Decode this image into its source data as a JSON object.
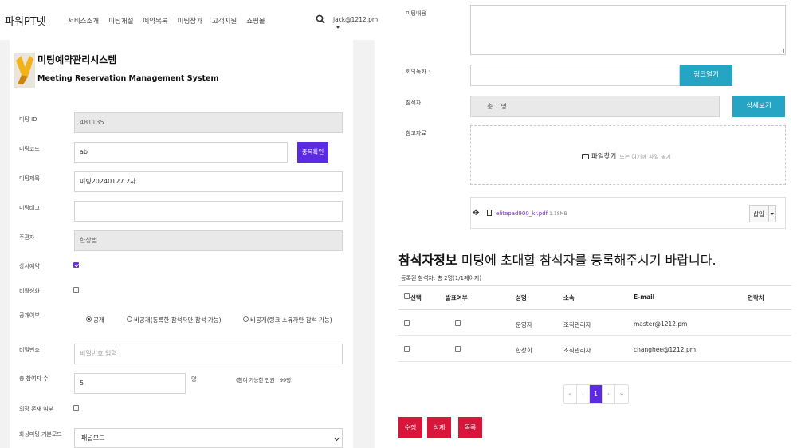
{
  "nav": {
    "brand": "파워PT넷",
    "menu": [
      "서비스소개",
      "미팅개설",
      "예약목록",
      "미팅참가",
      "고객지원",
      "쇼핑몰"
    ],
    "user": "jack@1212.pm"
  },
  "system": {
    "title_ko": "미팅예약관리시스템",
    "title_en": "Meeting Reservation Management System"
  },
  "form": {
    "meeting_id_label": "미팅 ID",
    "meeting_id": "481135",
    "meeting_code_label": "미팅코드",
    "meeting_code": "ab",
    "dup_check_label": "중복확인",
    "meeting_title_label": "미팅제목",
    "meeting_title": "미팅20240127 2차",
    "meeting_tag_label": "미팅태그",
    "meeting_tag": "",
    "host_label": "주관자",
    "host": "한상범",
    "always_reserve_label": "상시예약",
    "always_reserve": true,
    "private_label": "비활성화",
    "private": false,
    "public_label": "공개여부",
    "public_options": [
      "공개",
      "비공개(등록한 참석자만 참석 가능)",
      "비공개(링크 소유자만 참석 가능)"
    ],
    "public_selected": 0,
    "password_label": "비밀번호",
    "password_placeholder": "비밀번호 입력",
    "total_label": "총 참여자 수",
    "total": "5",
    "total_unit": "명",
    "total_note": "(참여 가능한 인원 : 99명)",
    "chair_label": "의장 존재 여부",
    "chair": false,
    "mode_label": "화상미팅 기본모드",
    "mode": "패널모드"
  },
  "right": {
    "content_label": "미팅내용",
    "record_label": "회의녹화 :",
    "record_link_btn": "링크열기",
    "attendee_label": "참석자",
    "attendee_value": "총 1 명",
    "detail_btn": "상세보기",
    "ref_label": "참고자료",
    "find_file": "파일찾기",
    "drop_hint": "또는 여기에 파일 놓기",
    "file_name": "elitepad900_kr.pdf",
    "file_size": "1.18MB",
    "insert_btn": "삽입"
  },
  "participants": {
    "title_bold": "참석자정보",
    "title_rest": " 미팅에 초대할 참석자를 등록해주시기 바랍니다.",
    "count": "등록된 참석자: 총 2명(1/1페이지)",
    "headers": [
      "선택",
      "발표여부",
      "성명",
      "소속",
      "E-mail",
      "연락처"
    ],
    "rows": [
      {
        "name": "운영자",
        "org": "조직관리자",
        "email": "master@1212.pm",
        "phone": ""
      },
      {
        "name": "한창희",
        "org": "조직관리자",
        "email": "changhee@1212.pm",
        "phone": ""
      }
    ]
  },
  "pager": [
    "«",
    "‹",
    "1",
    "›",
    "»"
  ],
  "actions": [
    "수정",
    "삭제",
    "목록"
  ],
  "colors": {
    "purple": "#5a2be0",
    "teal": "#26a4c4",
    "red": "#d8163b"
  }
}
